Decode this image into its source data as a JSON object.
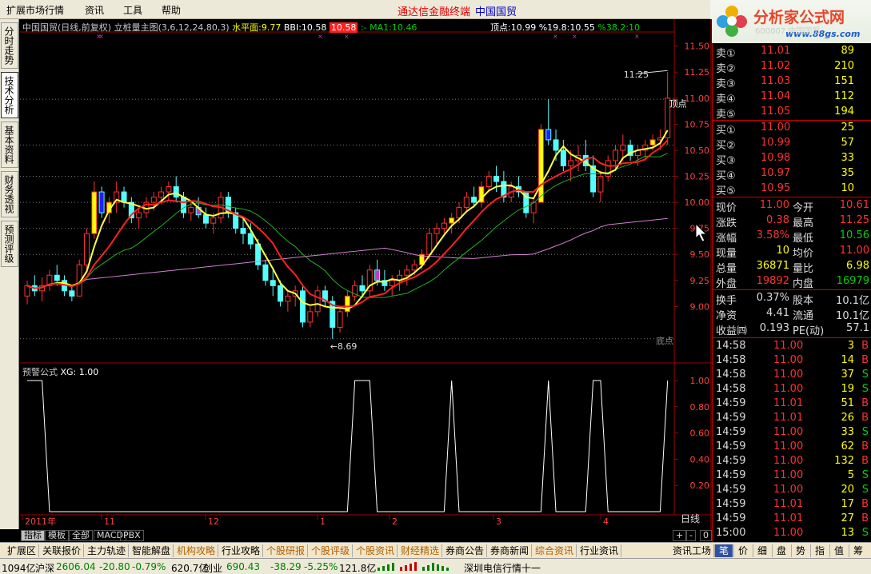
{
  "menu": [
    "扩展市场行情",
    "资讯",
    "工具",
    "帮助"
  ],
  "title": {
    "brand": "通达信金融终端",
    "stock": "中国国贸"
  },
  "logo": {
    "text": "分析家公式网",
    "url": "www.88gs.com",
    "faint": "600007 中国国贸"
  },
  "vtabs": [
    "分时走势",
    "技术分析",
    "基本资料",
    "财务透视",
    "预测评级"
  ],
  "header": {
    "name": "中国国贸(日线,前复权)",
    "indicator": "立桩量主图(3,6,12,24,80,3)",
    "level_label": "水平面:",
    "level_value": "9.77",
    "bbi_label": "BBI:",
    "bbi_value": "10.58",
    "extra_value": "10.58",
    "ma1_label": ":- MA1:",
    "ma1_value": "10.46",
    "peak_label": "顶点:",
    "peak_value": "10.99",
    "pct1": "%19.8:",
    "pct1_value": "10.55",
    "pct2": "%38.2:",
    "pct2_value": "10"
  },
  "price_axis": [
    "11.50",
    "11.25",
    "11.00",
    "10.75",
    "10.50",
    "10.25",
    "10.00",
    "9.75",
    "9.50",
    "9.25",
    "9.00"
  ],
  "annotations": {
    "high": "11.25",
    "low": "8.69",
    "peak_tag": "顶点",
    "bottom_tag": "底点"
  },
  "sub": {
    "title": "预警公式",
    "xg_label": "XG:",
    "xg_value": "1.00",
    "axis": [
      "1.00",
      "0.80",
      "0.60",
      "0.40",
      "0.20"
    ],
    "period": "日线"
  },
  "date_axis": [
    "2011年",
    "11",
    "12",
    "1",
    "2",
    "3",
    "4"
  ],
  "bottom_tabs": [
    "指标",
    "模板",
    "全部",
    "MACD",
    "PBX"
  ],
  "bottom_ctrl": [
    "+",
    "-",
    "0"
  ],
  "chart_data": {
    "type": "candlestick",
    "ohlc": [
      [
        9.1,
        9.25,
        9.02,
        9.2
      ],
      [
        9.2,
        9.3,
        9.1,
        9.15
      ],
      [
        9.15,
        9.28,
        9.05,
        9.2
      ],
      [
        9.2,
        9.35,
        9.15,
        9.3
      ],
      [
        9.3,
        9.4,
        9.2,
        9.25
      ],
      [
        9.25,
        9.3,
        9.1,
        9.15
      ],
      [
        9.15,
        9.2,
        9.05,
        9.1
      ],
      [
        9.1,
        9.45,
        9.1,
        9.4
      ],
      [
        9.4,
        9.75,
        9.35,
        9.7
      ],
      [
        9.7,
        10.2,
        9.65,
        10.1
      ],
      [
        10.1,
        10.15,
        9.85,
        9.9
      ],
      [
        9.9,
        10.05,
        9.8,
        10.0
      ],
      [
        10.0,
        10.2,
        9.9,
        10.1
      ],
      [
        10.1,
        10.15,
        9.95,
        10.0
      ],
      [
        10.0,
        10.05,
        9.8,
        9.85
      ],
      [
        9.85,
        9.95,
        9.75,
        9.9
      ],
      [
        9.9,
        10.05,
        9.85,
        10.0
      ],
      [
        10.0,
        10.1,
        9.92,
        10.05
      ],
      [
        10.05,
        10.15,
        9.98,
        10.1
      ],
      [
        10.1,
        10.2,
        10.02,
        10.15
      ],
      [
        10.15,
        10.25,
        10.0,
        10.05
      ],
      [
        10.05,
        10.1,
        9.85,
        9.9
      ],
      [
        9.9,
        10.0,
        9.82,
        9.95
      ],
      [
        9.95,
        10.05,
        9.85,
        9.88
      ],
      [
        9.88,
        9.95,
        9.75,
        9.8
      ],
      [
        9.8,
        9.9,
        9.7,
        9.85
      ],
      [
        9.85,
        10.1,
        9.8,
        10.05
      ],
      [
        10.05,
        10.1,
        9.85,
        9.9
      ],
      [
        9.9,
        9.95,
        9.7,
        9.75
      ],
      [
        9.75,
        9.85,
        9.6,
        9.7
      ],
      [
        9.7,
        9.8,
        9.55,
        9.6
      ],
      [
        9.6,
        9.65,
        9.35,
        9.4
      ],
      [
        9.4,
        9.45,
        9.2,
        9.25
      ],
      [
        9.25,
        9.35,
        9.1,
        9.2
      ],
      [
        9.2,
        9.25,
        9.0,
        9.05
      ],
      [
        9.05,
        9.15,
        8.95,
        9.1
      ],
      [
        9.1,
        9.2,
        9.0,
        9.15
      ],
      [
        9.15,
        9.2,
        8.8,
        8.85
      ],
      [
        8.85,
        9.0,
        8.8,
        8.95
      ],
      [
        8.95,
        9.2,
        8.9,
        9.15
      ],
      [
        9.15,
        9.2,
        9.0,
        9.05
      ],
      [
        9.05,
        9.1,
        8.69,
        8.8
      ],
      [
        8.8,
        9.0,
        8.75,
        8.95
      ],
      [
        8.95,
        9.15,
        8.9,
        9.1
      ],
      [
        9.1,
        9.25,
        9.05,
        9.2
      ],
      [
        9.2,
        9.3,
        9.1,
        9.15
      ],
      [
        9.15,
        9.4,
        9.1,
        9.35
      ],
      [
        9.35,
        9.45,
        9.2,
        9.25
      ],
      [
        9.25,
        9.35,
        9.15,
        9.2
      ],
      [
        9.2,
        9.3,
        9.1,
        9.25
      ],
      [
        9.25,
        9.35,
        9.15,
        9.3
      ],
      [
        9.3,
        9.4,
        9.2,
        9.35
      ],
      [
        9.35,
        9.45,
        9.3,
        9.4
      ],
      [
        9.4,
        9.55,
        9.35,
        9.5
      ],
      [
        9.5,
        9.75,
        9.45,
        9.7
      ],
      [
        9.7,
        9.8,
        9.6,
        9.75
      ],
      [
        9.75,
        9.85,
        9.7,
        9.8
      ],
      [
        9.8,
        9.9,
        9.7,
        9.85
      ],
      [
        9.85,
        10.0,
        9.8,
        9.95
      ],
      [
        9.95,
        10.1,
        9.9,
        10.05
      ],
      [
        10.05,
        10.15,
        9.95,
        10.0
      ],
      [
        10.0,
        10.2,
        9.95,
        10.15
      ],
      [
        10.15,
        10.3,
        10.1,
        10.25
      ],
      [
        10.25,
        10.35,
        10.1,
        10.2
      ],
      [
        10.2,
        10.3,
        10.0,
        10.05
      ],
      [
        10.05,
        10.2,
        10.0,
        10.15
      ],
      [
        10.15,
        10.25,
        10.05,
        10.1
      ],
      [
        10.1,
        9.95,
        9.85,
        9.9
      ],
      [
        9.9,
        10.05,
        9.8,
        10.0
      ],
      [
        10.0,
        10.75,
        10.0,
        10.7
      ],
      [
        10.7,
        10.99,
        10.55,
        10.6
      ],
      [
        10.6,
        10.7,
        10.4,
        10.5
      ],
      [
        10.5,
        10.6,
        10.3,
        10.35
      ],
      [
        10.35,
        10.5,
        10.2,
        10.4
      ],
      [
        10.4,
        10.55,
        10.3,
        10.45
      ],
      [
        10.45,
        10.6,
        10.3,
        10.35
      ],
      [
        10.35,
        10.45,
        10.05,
        10.1
      ],
      [
        10.1,
        10.3,
        10.0,
        10.25
      ],
      [
        10.25,
        10.45,
        10.2,
        10.4
      ],
      [
        10.4,
        10.55,
        10.3,
        10.5
      ],
      [
        10.5,
        10.65,
        10.4,
        10.55
      ],
      [
        10.55,
        10.6,
        10.4,
        10.45
      ],
      [
        10.45,
        10.55,
        10.35,
        10.5
      ],
      [
        10.5,
        10.6,
        10.4,
        10.55
      ],
      [
        10.55,
        10.65,
        10.5,
        10.6
      ],
      [
        10.6,
        10.7,
        10.5,
        10.62
      ],
      [
        10.62,
        11.25,
        10.55,
        11.0
      ]
    ],
    "ma_bbi": "red",
    "ma_short": "yellow",
    "ma_mid": "green",
    "ma_long": "violet",
    "xg_series": [
      1,
      1,
      1,
      0,
      0,
      0,
      0,
      0,
      0,
      0,
      0,
      0,
      0,
      0,
      0,
      0,
      0,
      0,
      0,
      0,
      0,
      0,
      0,
      0,
      0,
      0,
      0,
      0,
      0,
      0,
      0,
      0,
      0,
      0,
      0,
      0,
      0,
      0,
      0,
      0,
      0,
      0,
      0,
      0,
      1,
      1,
      1,
      0,
      0,
      0,
      0,
      0,
      0,
      0,
      0,
      0,
      0,
      1,
      0,
      0,
      0,
      0,
      0,
      0,
      0,
      0,
      0,
      0,
      0,
      0,
      1,
      0,
      0,
      0,
      0,
      0,
      1,
      1,
      0,
      0,
      0,
      0,
      0,
      0,
      0,
      0,
      1
    ]
  },
  "quote": {
    "sells": [
      {
        "label": "卖⑤",
        "price": "11.05",
        "vol": "194"
      },
      {
        "label": "卖④",
        "price": "11.04",
        "vol": "112"
      },
      {
        "label": "卖③",
        "price": "11.03",
        "vol": "151"
      },
      {
        "label": "卖②",
        "price": "11.02",
        "vol": "210"
      },
      {
        "label": "卖①",
        "price": "11.01",
        "vol": "89"
      }
    ],
    "buys": [
      {
        "label": "买①",
        "price": "11.00",
        "vol": "25"
      },
      {
        "label": "买②",
        "price": "10.99",
        "vol": "57"
      },
      {
        "label": "买③",
        "price": "10.98",
        "vol": "33"
      },
      {
        "label": "买④",
        "price": "10.97",
        "vol": "35"
      },
      {
        "label": "买⑤",
        "price": "10.95",
        "vol": "10"
      }
    ],
    "stats": [
      {
        "l1": "现价",
        "v1": "11.00",
        "l2": "今开",
        "v2": "10.61"
      },
      {
        "l1": "涨跌",
        "v1": "0.38",
        "l2": "最高",
        "v2": "11.25"
      },
      {
        "l1": "涨幅",
        "v1": "3.58%",
        "l2": "最低",
        "v2": "10.56"
      },
      {
        "l1": "现量",
        "v1": "10",
        "l2": "均价",
        "v2": "11.00"
      },
      {
        "l1": "总量",
        "v1": "36871",
        "l2": "量比",
        "v2": "6.98"
      },
      {
        "l1": "外盘",
        "v1": "19892",
        "l2": "内盘",
        "v2": "16979"
      }
    ],
    "stats2": [
      {
        "l1": "换手",
        "v1": "0.37%",
        "l2": "股本",
        "v2": "10.1亿"
      },
      {
        "l1": "净资",
        "v1": "4.41",
        "l2": "流通",
        "v2": "10.1亿"
      },
      {
        "l1": "收益㈣",
        "v1": "0.193",
        "l2": "PE(动)",
        "v2": "57.1"
      }
    ],
    "ticks": [
      {
        "t": "14:58",
        "p": "11.00",
        "v": "3",
        "s": "B"
      },
      {
        "t": "14:58",
        "p": "11.00",
        "v": "14",
        "s": "B"
      },
      {
        "t": "14:58",
        "p": "11.00",
        "v": "37",
        "s": "S"
      },
      {
        "t": "14:58",
        "p": "11.00",
        "v": "19",
        "s": "S"
      },
      {
        "t": "14:59",
        "p": "11.01",
        "v": "51",
        "s": "B"
      },
      {
        "t": "14:59",
        "p": "11.01",
        "v": "26",
        "s": "B"
      },
      {
        "t": "14:59",
        "p": "11.00",
        "v": "33",
        "s": "S"
      },
      {
        "t": "14:59",
        "p": "11.00",
        "v": "62",
        "s": "B"
      },
      {
        "t": "14:59",
        "p": "11.00",
        "v": "132",
        "s": "B"
      },
      {
        "t": "14:59",
        "p": "11.00",
        "v": "5",
        "s": "S"
      },
      {
        "t": "14:59",
        "p": "11.00",
        "v": "20",
        "s": "S"
      },
      {
        "t": "14:59",
        "p": "11.01",
        "v": "17",
        "s": "B"
      },
      {
        "t": "14:59",
        "p": "11.01",
        "v": "27",
        "s": "B"
      },
      {
        "t": "15:00",
        "p": "11.00",
        "v": "13",
        "s": "S"
      }
    ]
  },
  "nav": [
    "扩展区",
    "关联报价",
    "主力轨迹",
    "智能解盘",
    "机构攻略",
    "行业攻略",
    "个股研报",
    "个股评级",
    "个股资讯",
    "财经精选",
    "券商公告",
    "券商新闻",
    "综合资讯",
    "行业资讯"
  ],
  "nav_right": {
    "label": "资讯工场",
    "tabs": [
      "笔",
      "价",
      "细",
      "盘",
      "势",
      "指",
      "值",
      "筹"
    ]
  },
  "status": {
    "vol_sh": "1094亿",
    "sh_label": "沪深",
    "sh_value": "2606.04",
    "sh_chg": "-20.80",
    "sh_pct": "-0.79%",
    "sh_amt": "620.7亿",
    "cy_label": "创业",
    "cy_value": "690.43",
    "cy_chg": "-38.29",
    "cy_pct": "-5.25%",
    "cy_amt": "121.8亿",
    "feed": "深圳电信行情十一"
  }
}
